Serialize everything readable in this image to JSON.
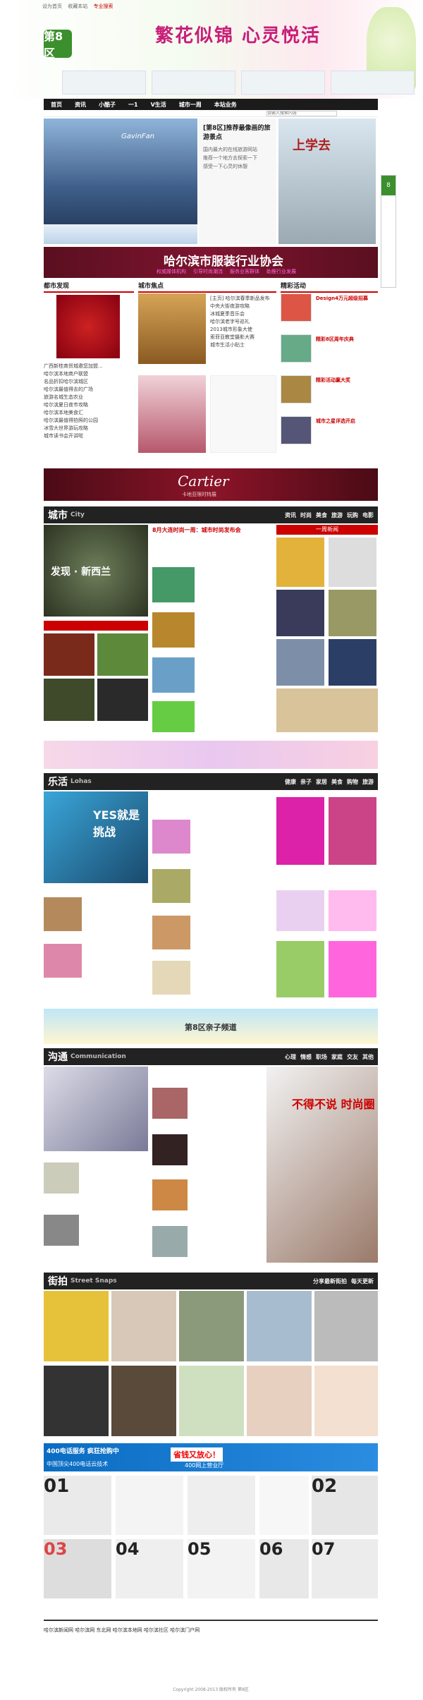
{
  "top_links": [
    "设为首页",
    "收藏本站",
    "专业搜索"
  ],
  "logo_text": "第8区",
  "banner_slogan": "繁花似锦 心灵悦活",
  "nav": [
    "首页",
    "资讯",
    "小酷子",
    "一1",
    "V生活",
    "城市一周",
    "本站业务"
  ],
  "search_placeholder": "请输入搜索内容",
  "hero_caption": "[第8区]推荐最像画的旅游景点",
  "hero_lines": [
    "国内最大的在线旅游网站",
    "推荐一个地方去探索一下",
    "感受一下心灵的休憩"
  ],
  "side_promo": "上学去",
  "assoc_banner": "哈尔滨市服装行业协会",
  "assoc_sub": [
    "权威媒体机构",
    "引导时尚潮流",
    "服务业客群体",
    "助推行业发展"
  ],
  "col_heads": [
    "都市发现",
    "城市焦点",
    "精彩活动"
  ],
  "city_list": [
    "广西新桂商贸城邀您加盟...",
    "哈尔滨本地商户联盟",
    "名品折扣哈尔滨城区",
    "哈尔滨最值得去的广场",
    "旅游名城生态农业",
    "哈尔滨夏日夜市攻略",
    "哈尔滨本地美食汇",
    "哈尔滨最值得拍照的公园",
    "冰雪大世界游玩攻略",
    "城市读书会开讲啦"
  ],
  "focus_list": [
    "[主页] 哈尔滨春季新品发布",
    "中央大街夜游攻略",
    "冰城夏季音乐会",
    "哈尔滨老字号巡礼",
    "2013城市形象大使",
    "索菲亚教堂摄影大赛",
    "城市生活小贴士"
  ],
  "activity_items": [
    "Design4万元超级招募",
    "精彩8区周年庆典",
    "精彩活动赢大奖",
    "城市之星评选开启"
  ],
  "cartier": "Cartier",
  "cartier_sub": "卡地亚限时特展",
  "sections": [
    {
      "zh": "城市",
      "en": "City",
      "tabs": [
        "资讯",
        "时尚",
        "美食",
        "旅游",
        "玩购",
        "电影"
      ]
    },
    {
      "zh": "乐活",
      "en": "Lohas",
      "tabs": [
        "健康",
        "亲子",
        "家居",
        "美食",
        "购物",
        "旅游"
      ]
    },
    {
      "zh": "沟通",
      "en": "Communication",
      "tabs": [
        "心理",
        "情感",
        "职场",
        "家庭",
        "交友",
        "其他"
      ]
    },
    {
      "zh": "街拍",
      "en": "Street Snaps",
      "tabs": [
        "分享最新街拍",
        "每天更新"
      ]
    }
  ],
  "city_feature": "发现 · 新西兰",
  "city_headline": "8月大连时尚一周：城市时尚发布会",
  "city_tab": "一周新闻",
  "lohas_feature": "YES就是挑战",
  "comm_feature": "不得不说 时尚圈",
  "ads": [
    "400电话服务 疯狂抢购中",
    "省钱又放心！",
    "中国顶尖400电话云技术",
    "400网上营业厅"
  ],
  "kids_banner": "第8区亲子频道",
  "gallery_labels": [
    "01",
    "02",
    "03",
    "04",
    "05",
    "06",
    "07"
  ],
  "footer_links": [
    "哈尔滨新闻网",
    "哈尔滨网",
    "东北网",
    "哈尔滨本地网",
    "哈尔滨社区",
    "哈尔滨门户网"
  ],
  "footer_copy": "Copyright 2008-2013 版权所有 第8区"
}
